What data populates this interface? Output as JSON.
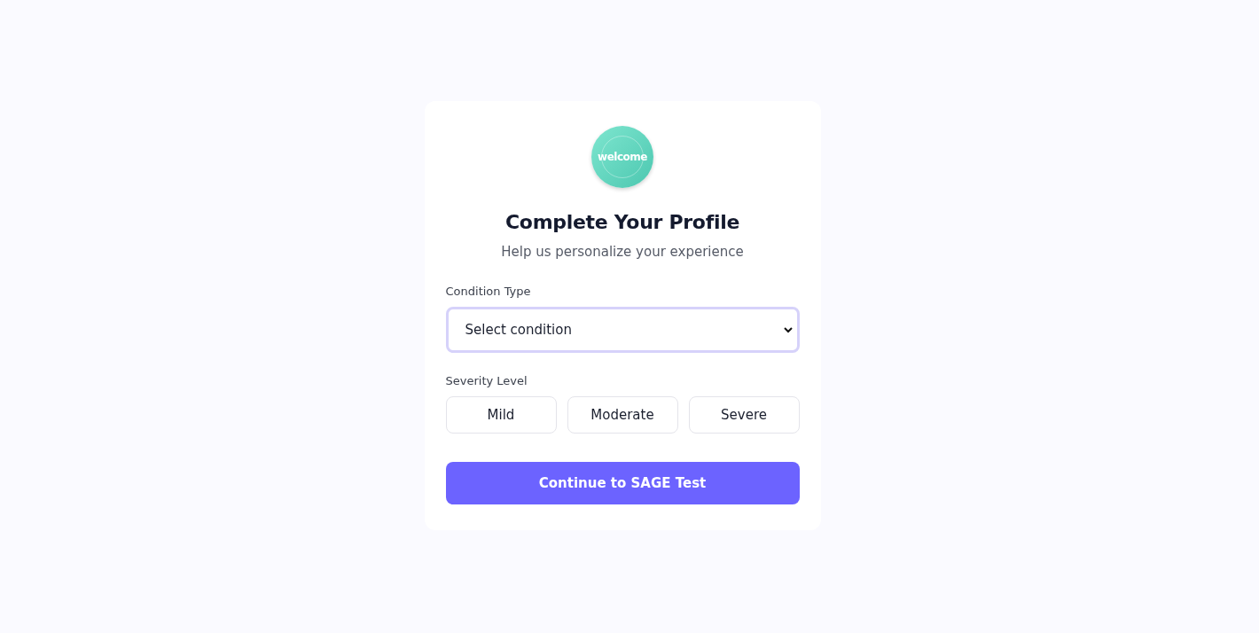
{
  "logo": {
    "text": "welcome"
  },
  "title": "Complete Your Profile",
  "subtitle": "Help us personalize your experience",
  "condition": {
    "label": "Condition Type",
    "value": "Select condition",
    "focused": true
  },
  "severity": {
    "label": "Severity Level",
    "options": [
      {
        "label": "Mild",
        "selected": false
      },
      {
        "label": "Moderate",
        "selected": false
      },
      {
        "label": "Severe",
        "selected": false
      }
    ]
  },
  "submit": "Continue to SAGE Test"
}
